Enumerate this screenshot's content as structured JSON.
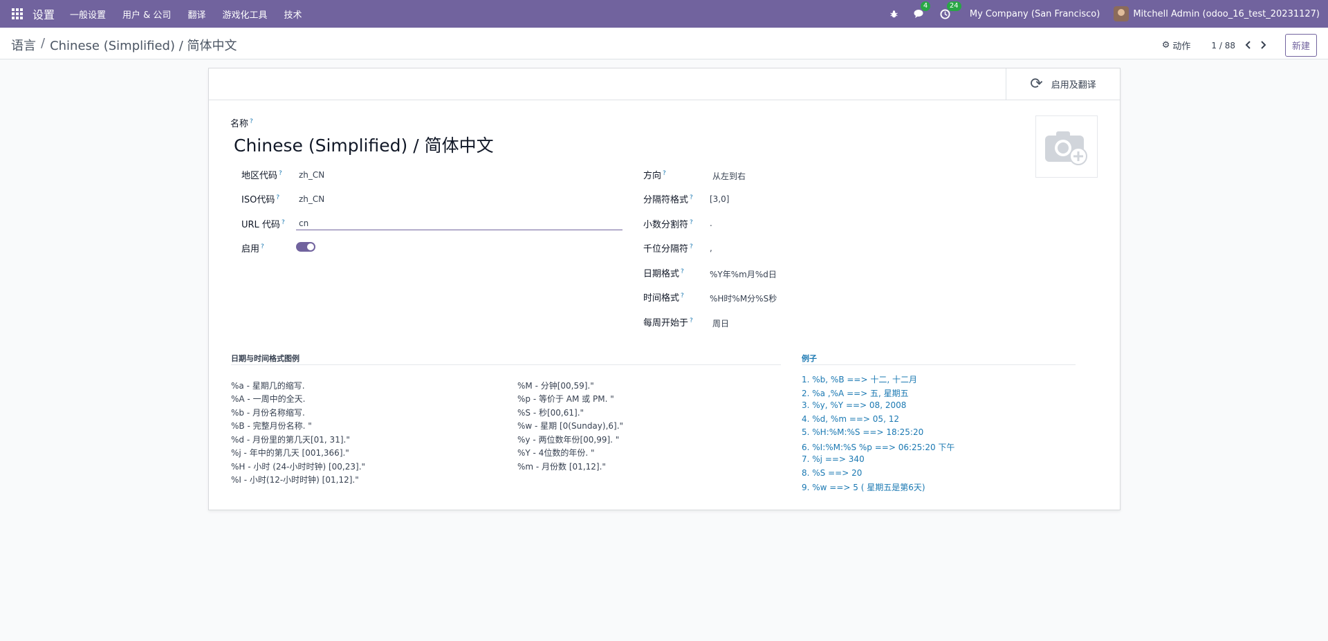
{
  "navbar": {
    "brand": "设置",
    "menu": [
      "一般设置",
      "用户 & 公司",
      "翻译",
      "游戏化工具",
      "技术"
    ],
    "messages_badge": "4",
    "activities_badge": "24",
    "company": "My Company (San Francisco)",
    "user": "Mitchell Admin (odoo_16_test_20231127)"
  },
  "control_panel": {
    "breadcrumb_root": "语言",
    "breadcrumb_current": "Chinese (Simplified) / 简体中文",
    "action_label": "动作",
    "pager": "1 / 88",
    "new_label": "新建"
  },
  "statusbar": {
    "activate_label": "启用及翻译"
  },
  "form": {
    "name_label": "名称",
    "name_value": "Chinese (Simplified) / 简体中文",
    "left_fields": {
      "locale_label": "地区代码",
      "locale_value": "zh_CN",
      "iso_label": "ISO代码",
      "iso_value": "zh_CN",
      "url_label": "URL 代码",
      "url_value": "cn",
      "active_label": "启用",
      "active_value": true
    },
    "right_fields": {
      "direction_label": "方向",
      "direction_value": "从左到右",
      "grouping_label": "分隔符格式",
      "grouping_value": "[3,0]",
      "decimal_label": "小数分割符",
      "decimal_value": ".",
      "thousands_label": "千位分隔符",
      "thousands_value": ",",
      "date_label": "日期格式",
      "date_value": "%Y年%m月%d日",
      "time_label": "时间格式",
      "time_value": "%H时%M分%S秒",
      "week_label": "每周开始于",
      "week_value": "周日"
    }
  },
  "legend": {
    "title": "日期与时间格式图例",
    "col1": [
      "%a - 星期几的缩写.",
      "%A - 一周中的全天.",
      "%b - 月份名称缩写.",
      "%B - 完整月份名称. \"",
      "%d - 月份里的第几天[01, 31].\"",
      "%j - 年中的第几天 [001,366].\"",
      "%H - 小时 (24-小时时钟) [00,23].\"",
      "%I - 小时(12-小时时钟) [01,12].\""
    ],
    "col2": [
      "%M - 分钟[00,59].\"",
      "%p - 等价于 AM 或 PM. \"",
      "%S - 秒[00,61].\"",
      "%w - 星期 [0(Sunday),6].\"",
      "%y - 两位数年份[00,99]. \"",
      "%Y - 4位数的年份. \"",
      "%m - 月份数 [01,12].\""
    ]
  },
  "examples": {
    "title": "例子",
    "items": [
      "1. %b, %B ==> 十二, 十二月",
      "2. %a ,%A ==> 五, 星期五",
      "3. %y, %Y ==> 08, 2008",
      "4. %d, %m ==> 05, 12",
      "5. %H:%M:%S ==> 18:25:20",
      "6. %I:%M:%S %p ==> 06:25:20 下午",
      "7. %j ==> 340",
      "8. %S ==> 20",
      "9. %w ==> 5 ( 星期五是第6天)"
    ]
  },
  "colors": {
    "primary": "#71639e",
    "link": "#1a78b2",
    "badge": "#28a745"
  }
}
